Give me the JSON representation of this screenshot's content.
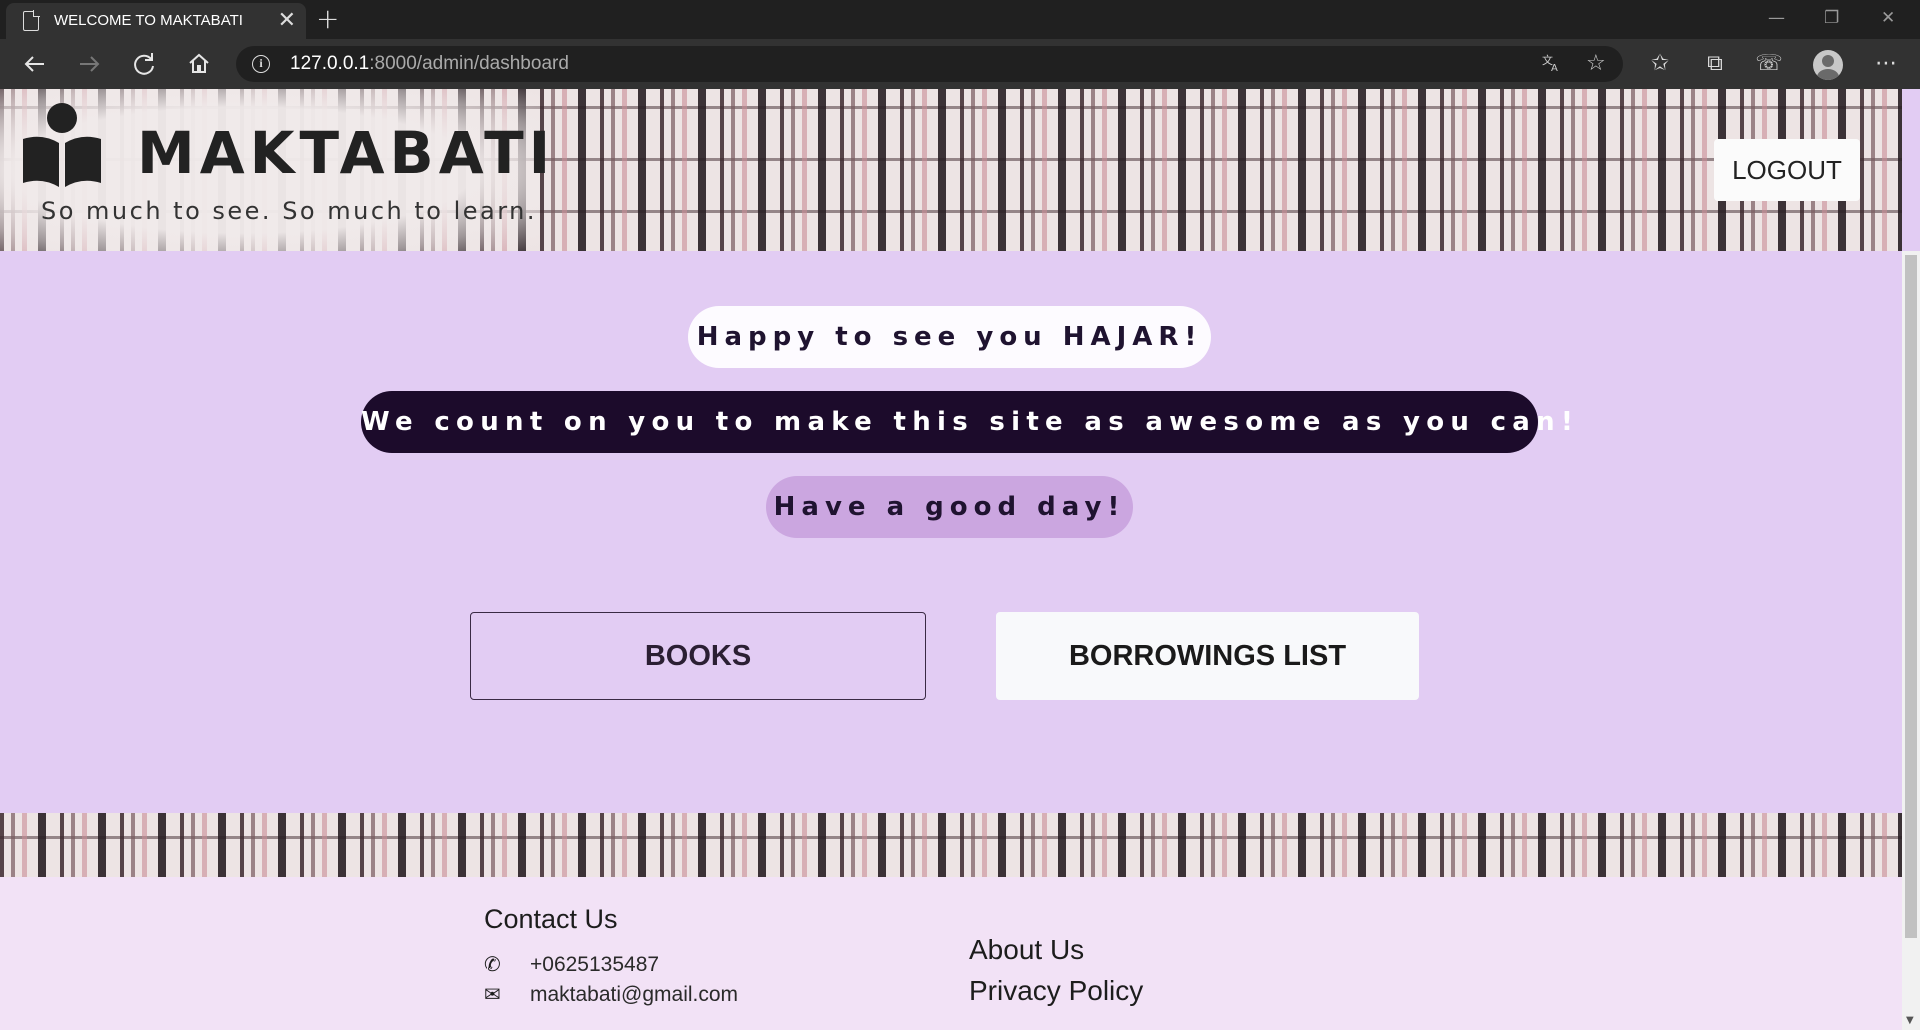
{
  "browser": {
    "tab_title": "WELCOME TO MAKTABATI",
    "tab_close": "✕",
    "new_tab": "+",
    "url_host": "127.0.0.1",
    "url_rest": ":8000/admin/dashboard",
    "window_controls": [
      "—",
      "❐",
      "✕"
    ]
  },
  "header": {
    "brand_name": "MAKTABATI",
    "tagline": "So much to see. So much to learn.",
    "logout_label": "LOGOUT"
  },
  "greeting": {
    "line1": "Happy to see you HAJAR!",
    "line2": "We count on you to make this site as awesome as you can!",
    "line3": "Have a good day!"
  },
  "actions": {
    "books_label": "BOOKS",
    "borrowings_label": "BORROWINGS LIST"
  },
  "footer": {
    "contact_title": "Contact Us",
    "phone": "+0625135487",
    "email": "maktabati@gmail.com",
    "about_label": "About Us",
    "privacy_label": "Privacy Policy"
  },
  "icons": {
    "phone": "phone-icon",
    "email": "envelope-icon"
  }
}
